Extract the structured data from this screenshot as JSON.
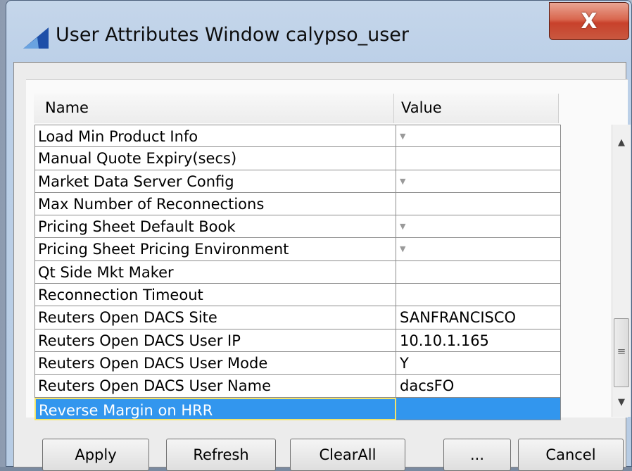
{
  "window": {
    "title": "User Attributes Window calypso_user",
    "close_label": "X"
  },
  "table": {
    "columns": [
      "Name",
      "Value"
    ],
    "rows": [
      {
        "name": "Load Min Product Info",
        "value": "",
        "dropdown": true
      },
      {
        "name": "Manual Quote Expiry(secs)",
        "value": "",
        "dropdown": false
      },
      {
        "name": "Market Data Server Config",
        "value": "",
        "dropdown": true
      },
      {
        "name": "Max Number of Reconnections",
        "value": "",
        "dropdown": false
      },
      {
        "name": "Pricing Sheet Default Book",
        "value": "",
        "dropdown": true
      },
      {
        "name": "Pricing Sheet Pricing Environment",
        "value": "",
        "dropdown": true
      },
      {
        "name": "Qt Side Mkt Maker",
        "value": "",
        "dropdown": false
      },
      {
        "name": "Reconnection Timeout",
        "value": "",
        "dropdown": false
      },
      {
        "name": "Reuters Open DACS Site",
        "value": "SANFRANCISCO",
        "dropdown": false
      },
      {
        "name": "Reuters Open DACS User IP",
        "value": "10.10.1.165",
        "dropdown": false
      },
      {
        "name": "Reuters Open DACS User Mode",
        "value": "Y",
        "dropdown": false
      },
      {
        "name": "Reuters Open DACS User Name",
        "value": "dacsFO",
        "dropdown": false
      },
      {
        "name": "Reverse Margin on HRR",
        "value": "",
        "dropdown": false,
        "selected": true
      }
    ]
  },
  "buttons": {
    "apply": "Apply",
    "refresh": "Refresh",
    "clearall": "ClearAll",
    "more": "...",
    "cancel": "Cancel"
  },
  "colors": {
    "selection": "#3296ee",
    "close_button": "#c8412b"
  }
}
